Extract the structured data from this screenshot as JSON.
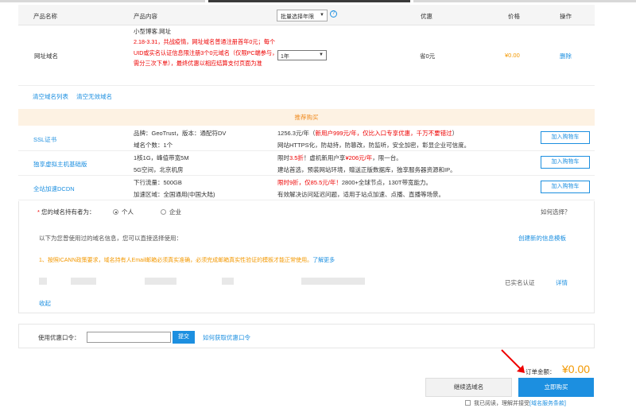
{
  "header": {
    "col_product_name": "产品名称",
    "col_product_content": "产品内容",
    "col_year_select": "批量选择年限",
    "col_discount": "优惠",
    "col_price": "价格",
    "col_action": "操作"
  },
  "domain_row": {
    "label": "网址域名",
    "product": "小型博客.网址",
    "note": "2.18-3.31，共战疫情，网址域名普通注册首年0元；每个UID或实名认证信息限注册3个0元域名（仅限PC端参与，需分三次下单），最终优惠以相应结算支付页面为准",
    "year_value": "1年",
    "discount": "省0元",
    "price": "¥0.00",
    "delete": "删除"
  },
  "clear_links": {
    "clear_list": "清空域名列表",
    "clear_invalid": "清空无效域名"
  },
  "recommend": {
    "title": "推荐购买",
    "add_cart": "加入购物车",
    "items": [
      {
        "name": "SSL证书",
        "d1": "品牌：GeoTrust，版本：通配符DV",
        "d2": "域名个数：1个",
        "p1a": "1256.3元/年（",
        "p1b": "新用户999元/年，仅比入口专享优惠，千万不要错过",
        "p1c": "）",
        "p2": "网站HTTPS化，防劫持，防篡改，防监听，安全加密，彰显企业可信度。"
      },
      {
        "name": "独享虚拟主机基础版",
        "d1": "1核1G，峰值带宽5M",
        "d2": "5G空间，北京机房",
        "p1a": "限时",
        "p1b": "3.5折",
        "p1c": "！虚机新用户享",
        "p1d": "¥206元/年",
        "p1e": "，限一台。",
        "p2": "建站首选，预装网站环境，赠送正版数据库，独享服务器资源和IP。"
      },
      {
        "name": "全站加速DCDN",
        "d1": "下行流量：500GB",
        "d2": "加速区域：全国通用(中国大陆)",
        "p1a": "限时9折，仅85.5元/年！",
        "p1b": "2800+全球节点，130T带宽能力。",
        "p2": "有效解决访问延迟问题，适用于站点加速、点播、直播等场景。"
      }
    ]
  },
  "holder": {
    "question": "您的域名持有者为：",
    "opt_personal": "个人",
    "opt_company": "企业",
    "how_choose": "如何选择？",
    "intro": "以下为您曾使用过的域名信息，您可以直接选择使用：",
    "create_template": "创建新的信息模板",
    "warn": "1、按照ICANN政策要求，域名持有人Email邮箱必须真实准确，必须完成邮箱真实性验证的模板才能正常使用。",
    "learn_more": "了解更多",
    "verified": "已实名认证",
    "detail": "详情",
    "collapse": "收起"
  },
  "coupon": {
    "label": "使用优惠口令：",
    "input_value": "",
    "submit": "提交",
    "how_get": "如何获取优惠口令"
  },
  "order": {
    "total_label": "订单金额：",
    "total_value": "¥0.00",
    "continue": "继续选域名",
    "buy_now": "立即购买",
    "agree_text": "我已阅读，理解并接受",
    "terms": "[域名服务条款]"
  },
  "colors": {
    "accent": "#1c8fe0",
    "orange": "#f39800",
    "red": "#e00000"
  },
  "icons": [
    "help-icon",
    "dropdown-arrow-icon",
    "red-arrow-icon",
    "radio-icon",
    "checkbox-icon"
  ]
}
